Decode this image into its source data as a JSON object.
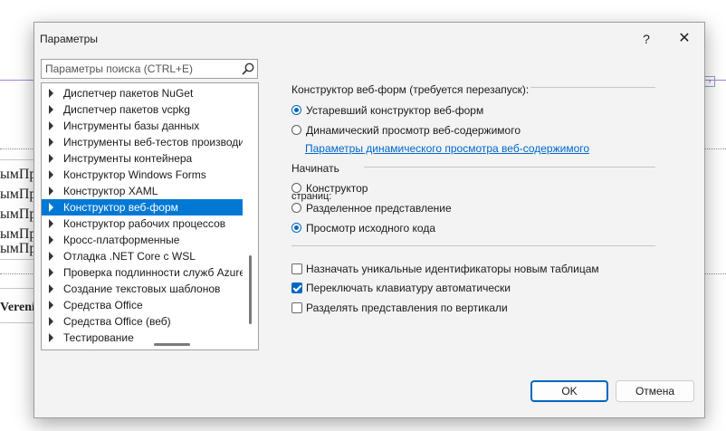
{
  "background": {
    "line_texts": [
      "ымПр",
      "ымПр",
      "ымПр",
      "ымПр",
      "ымПр"
    ],
    "bold_text": "Verení"
  },
  "dialog": {
    "title": "Параметры",
    "help_glyph": "?",
    "close_glyph": "✕",
    "search_placeholder": "Параметры поиска (CTRL+E)",
    "tree_items": [
      {
        "label": "Диспетчер пакетов NuGet",
        "selected": false
      },
      {
        "label": "Диспетчер пакетов vcpkg",
        "selected": false
      },
      {
        "label": "Инструменты базы данных",
        "selected": false
      },
      {
        "label": "Инструменты веб-тестов производи",
        "selected": false
      },
      {
        "label": "Инструменты контейнера",
        "selected": false
      },
      {
        "label": "Конструктор Windows Forms",
        "selected": false
      },
      {
        "label": "Конструктор XAML",
        "selected": false
      },
      {
        "label": "Конструктор веб-форм",
        "selected": true
      },
      {
        "label": "Конструктор рабочих процессов",
        "selected": false
      },
      {
        "label": "Кросс-платформенные",
        "selected": false
      },
      {
        "label": "Отладка .NET Core с WSL",
        "selected": false
      },
      {
        "label": "Проверка подлинности служб Azure",
        "selected": false
      },
      {
        "label": "Создание текстовых шаблонов",
        "selected": false
      },
      {
        "label": "Средства Office",
        "selected": false
      },
      {
        "label": "Средства Office (веб)",
        "selected": false
      },
      {
        "label": "Тестирование",
        "selected": false
      }
    ],
    "designer_section": {
      "header": "Конструктор веб-форм (требуется перезапуск):",
      "options": [
        {
          "label": "Устаревший конструктор веб-форм",
          "checked": true
        },
        {
          "label": "Динамический просмотр веб-содержимого",
          "checked": false
        }
      ],
      "link": "Параметры динамического просмотра веб-содержимого"
    },
    "start_section": {
      "header": "Начинать",
      "options": [
        {
          "label": "Конструктор",
          "checked": false
        },
        {
          "label": "Разделенное представление",
          "checked": false
        },
        {
          "label": "Просмотр исходного кода",
          "checked": true
        }
      ],
      "overlap_text": "страниц:"
    },
    "checkboxes": [
      {
        "label": "Назначать уникальные идентификаторы новым таблицам",
        "checked": false
      },
      {
        "label": "Переключать клавиатуру автоматически",
        "checked": true
      },
      {
        "label": "Разделять представления по вертикали",
        "checked": false
      }
    ],
    "ok_label": "OK",
    "cancel_label": "Отмена"
  },
  "colors": {
    "accent": "#0067c0",
    "selection": "#0078d4",
    "link": "#0066cc"
  }
}
